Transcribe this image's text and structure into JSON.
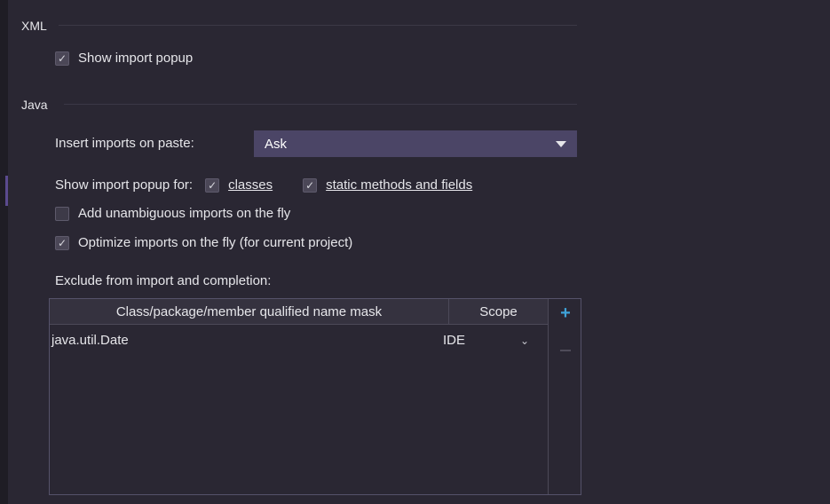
{
  "xml": {
    "title": "XML",
    "show_import_popup": {
      "label": "Show import popup",
      "checked": true
    }
  },
  "java": {
    "title": "Java",
    "insert_imports": {
      "label": "Insert imports on paste:",
      "value": "Ask"
    },
    "show_popup_for": {
      "label": "Show import popup for:",
      "classes": {
        "label": "classes",
        "checked": true
      },
      "static": {
        "label": "static methods and fields",
        "checked": true
      }
    },
    "add_unambiguous": {
      "label": "Add unambiguous imports on the fly",
      "checked": false
    },
    "optimize_imports": {
      "label": "Optimize imports on the fly (for current project)",
      "checked": true
    },
    "exclude": {
      "label": "Exclude from import and completion:",
      "columns": [
        "Class/package/member qualified name mask",
        "Scope"
      ],
      "rows": [
        {
          "mask": "java.util.Date",
          "scope": "IDE"
        }
      ],
      "add_icon": "plus-icon",
      "remove_icon": "minus-icon"
    }
  },
  "colors": {
    "background": "#2a2733",
    "combo": "#4b4566",
    "accent": "#3fa3d9"
  }
}
